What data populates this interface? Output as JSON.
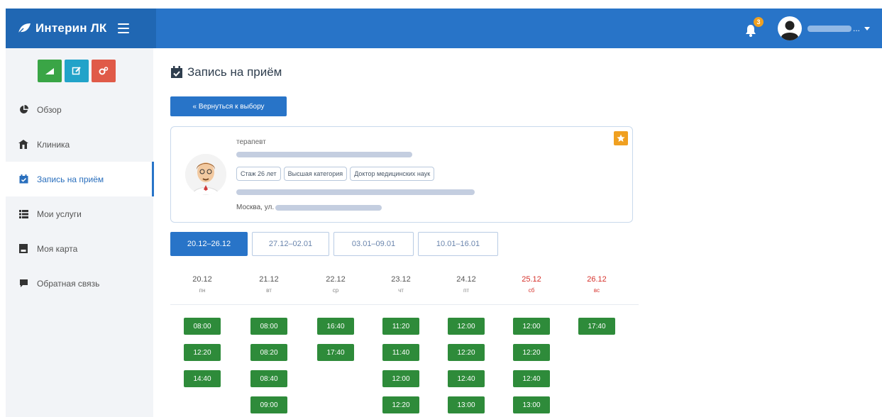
{
  "app": {
    "brand": "Интерин ЛК"
  },
  "header": {
    "notification_count": "3",
    "user_name_suffix": "...",
    "colors": {
      "topbar": "#2874c8",
      "badge": "#f0a020"
    }
  },
  "sidebar": {
    "quick_actions": [
      {
        "icon": "chart-icon",
        "color": "#3aa546"
      },
      {
        "icon": "edit-icon",
        "color": "#22a3c9"
      },
      {
        "icon": "cogs-icon",
        "color": "#e05a48"
      }
    ],
    "items": [
      {
        "label": "Обзор",
        "icon": "pie-chart-icon"
      },
      {
        "label": "Клиника",
        "icon": "hospital-icon"
      },
      {
        "label": "Запись на приём",
        "icon": "calendar-check-icon",
        "active": true
      },
      {
        "label": "Мои услуги",
        "icon": "list-icon"
      },
      {
        "label": "Моя карта",
        "icon": "card-icon"
      },
      {
        "label": "Обратная связь",
        "icon": "comment-icon"
      }
    ]
  },
  "main": {
    "title": "Запись на приём",
    "back_button": "« Вернуться к выбору",
    "doctor": {
      "specialty": "терапевт",
      "tags": [
        "Стаж 26 лет",
        "Высшая категория",
        "Доктор медицинских наук"
      ],
      "address_prefix": "Москва, ул."
    },
    "weeks": [
      {
        "label": "20.12–26.12",
        "active": true
      },
      {
        "label": "27.12–02.01",
        "active": false
      },
      {
        "label": "03.01–09.01",
        "active": false
      },
      {
        "label": "10.01–16.01",
        "active": false
      }
    ],
    "days": [
      {
        "date": "20.12",
        "weekday": "пн",
        "weekend": false,
        "slots": [
          "08:00",
          "12:20",
          "14:40"
        ]
      },
      {
        "date": "21.12",
        "weekday": "вт",
        "weekend": false,
        "slots": [
          "08:00",
          "08:20",
          "08:40",
          "09:00"
        ]
      },
      {
        "date": "22.12",
        "weekday": "ср",
        "weekend": false,
        "slots": [
          "16:40",
          "17:40"
        ]
      },
      {
        "date": "23.12",
        "weekday": "чт",
        "weekend": false,
        "slots": [
          "11:20",
          "11:40",
          "12:00",
          "12:20"
        ]
      },
      {
        "date": "24.12",
        "weekday": "пт",
        "weekend": false,
        "slots": [
          "12:00",
          "12:20",
          "12:40",
          "13:00"
        ]
      },
      {
        "date": "25.12",
        "weekday": "сб",
        "weekend": true,
        "slots": [
          "12:00",
          "12:20",
          "12:40",
          "13:00"
        ]
      },
      {
        "date": "26.12",
        "weekday": "вс",
        "weekend": true,
        "slots": [
          "17:40"
        ]
      }
    ]
  }
}
